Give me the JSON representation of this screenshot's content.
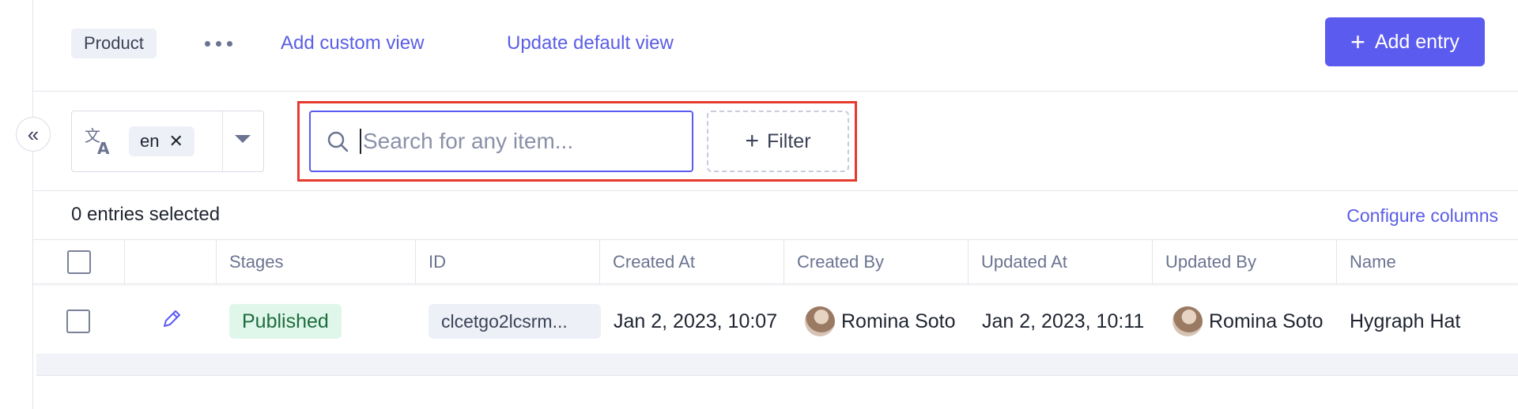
{
  "header": {
    "model_name": "Product",
    "add_custom_view": "Add custom view",
    "update_default_view": "Update default view",
    "add_entry": "Add entry"
  },
  "toolbar": {
    "locale": "en",
    "search_placeholder": "Search for any item...",
    "filter_label": "Filter"
  },
  "selection": {
    "count_label": "0 entries selected",
    "configure_columns": "Configure columns"
  },
  "table": {
    "columns": [
      "Stages",
      "ID",
      "Created At",
      "Created By",
      "Updated At",
      "Updated By",
      "Name"
    ],
    "rows": [
      {
        "stage": "Published",
        "id": "clcetgo2lcsrm...",
        "created_at": "Jan 2, 2023, 10:07",
        "created_by": "Romina Soto",
        "updated_at": "Jan 2, 2023, 10:11",
        "updated_by": "Romina Soto",
        "name": "Hygraph Hat"
      }
    ]
  },
  "colors": {
    "accent": "#5b5bf0",
    "highlight": "#e63a2e",
    "published_bg": "#dff7ea"
  },
  "icons": {
    "collapse": "double-chevron-left-icon",
    "translate": "translate-icon",
    "search": "search-icon",
    "edit": "pencil-icon"
  }
}
